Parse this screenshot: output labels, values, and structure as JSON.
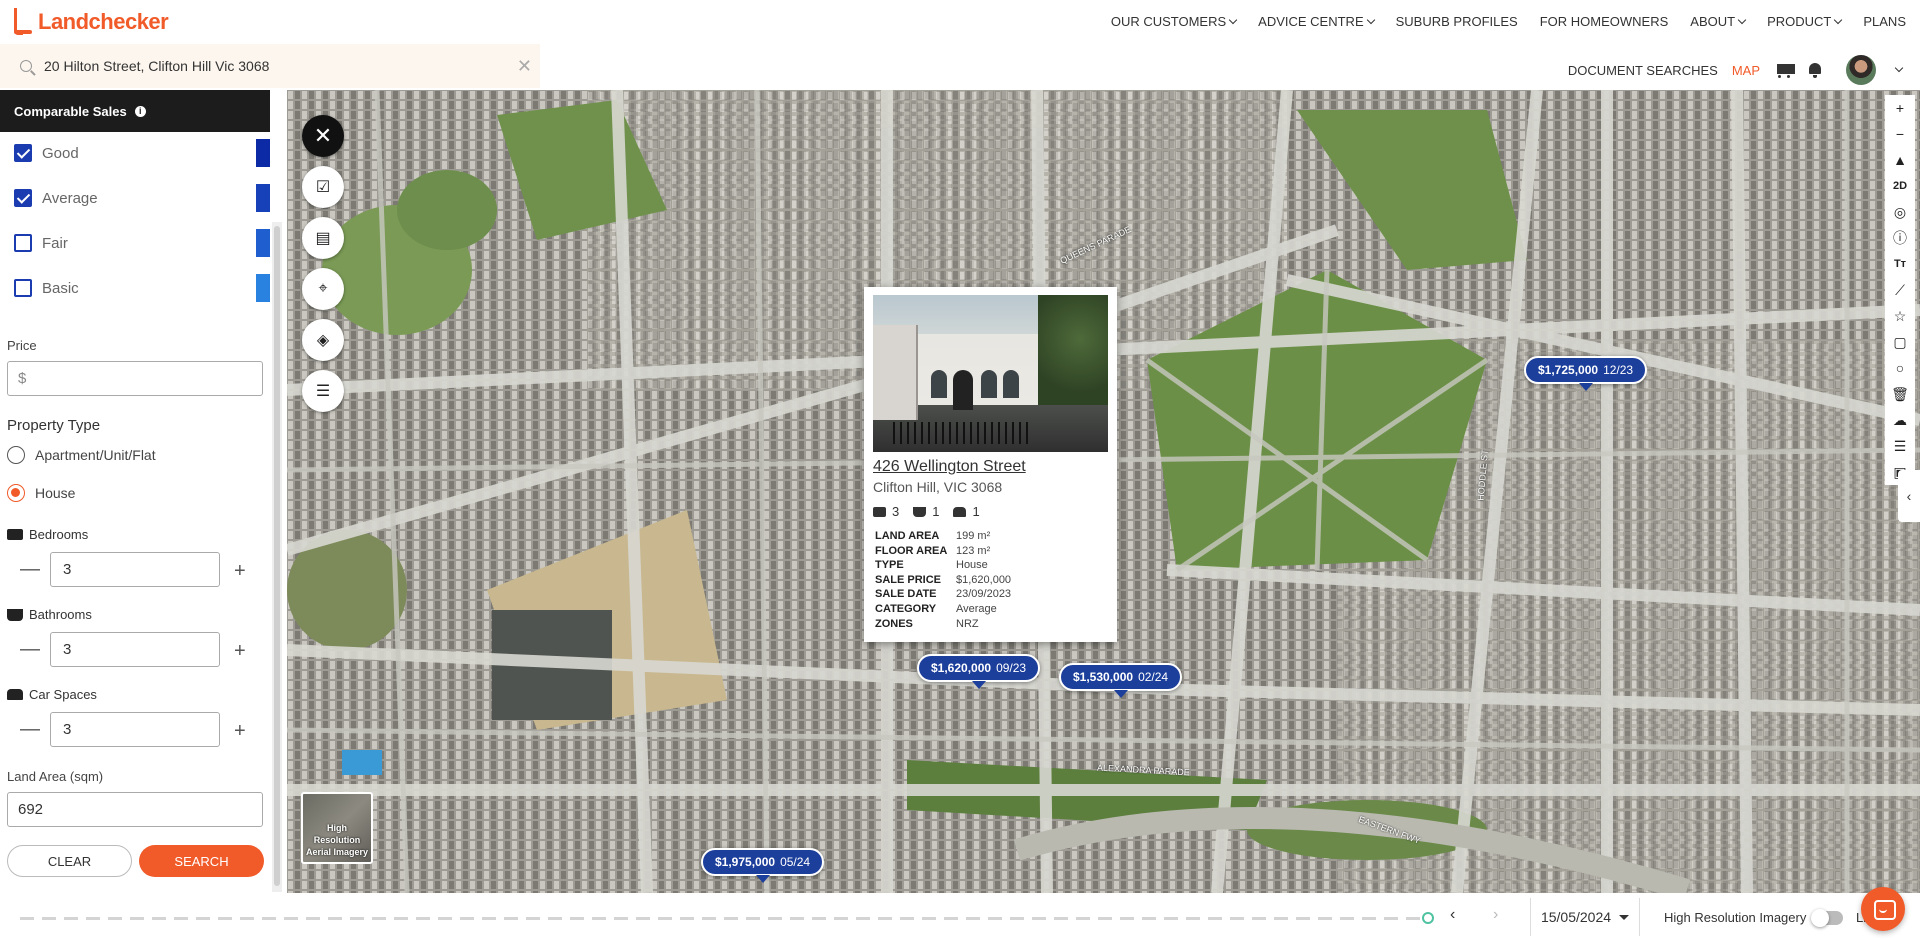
{
  "brand": {
    "name": "Landchecker",
    "accent": "#f15a29"
  },
  "nav": {
    "items": [
      {
        "label": "OUR CUSTOMERS",
        "has_menu": true
      },
      {
        "label": "ADVICE CENTRE",
        "has_menu": true
      },
      {
        "label": "SUBURB PROFILES",
        "has_menu": false
      },
      {
        "label": "FOR HOMEOWNERS",
        "has_menu": false
      },
      {
        "label": "ABOUT",
        "has_menu": true
      },
      {
        "label": "PRODUCT",
        "has_menu": true
      },
      {
        "label": "PLANS",
        "has_menu": false
      }
    ]
  },
  "search": {
    "value": "20 Hilton Street, Clifton Hill Vic 3068",
    "clear_icon": "close-icon"
  },
  "subnav": {
    "document_searches": "DOCUMENT SEARCHES",
    "map": "MAP",
    "cart_icon": "cart-icon",
    "bell_icon": "bell-icon"
  },
  "sidebar": {
    "title": "Comparable Sales",
    "categories": [
      {
        "label": "Good",
        "checked": true,
        "color": "#0d2aa6"
      },
      {
        "label": "Average",
        "checked": true,
        "color": "#1741b8"
      },
      {
        "label": "Fair",
        "checked": false,
        "color": "#1f5ecf"
      },
      {
        "label": "Basic",
        "checked": false,
        "color": "#2a82e0"
      }
    ],
    "price": {
      "label": "Price",
      "placeholder": "$"
    },
    "property_type": {
      "label": "Property Type",
      "options": [
        {
          "label": "Apartment/Unit/Flat",
          "selected": false
        },
        {
          "label": "House",
          "selected": true
        }
      ]
    },
    "bedrooms": {
      "label": "Bedrooms",
      "value": "3"
    },
    "bathrooms": {
      "label": "Bathrooms",
      "value": "3"
    },
    "car_spaces": {
      "label": "Car Spaces",
      "value": "3"
    },
    "land_area": {
      "label": "Land Area (sqm)",
      "value": "692"
    },
    "clear_label": "CLEAR",
    "search_label": "SEARCH"
  },
  "map": {
    "tools": [
      "close-icon",
      "checklist-icon",
      "clipboard-icon",
      "location-search-icon",
      "layers-icon",
      "list-icon"
    ],
    "right_tools": [
      "+",
      "−",
      "▲",
      "2D",
      "◎",
      "ⓘ",
      "Tт",
      "⟋",
      "☆",
      "▢",
      "○",
      "🗑",
      "☁",
      "☰",
      "▣"
    ],
    "imagery_label": "High Resolution Aerial Imagery",
    "markers": [
      {
        "price": "$1,725,000",
        "date": "12/23"
      },
      {
        "price": "$1,620,000",
        "date": "09/23"
      },
      {
        "price": "$1,530,000",
        "date": "02/24"
      },
      {
        "price": "$1,975,000",
        "date": "05/24"
      }
    ],
    "labels": [
      "QUEENS PARADE",
      "ALEXANDRA PARADE",
      "HODDLE ST",
      "EASTERN FWY"
    ]
  },
  "popup": {
    "address": "426 Wellington Street",
    "suburb": "Clifton Hill, VIC 3068",
    "beds": "3",
    "baths": "1",
    "cars": "1",
    "details": [
      {
        "label": "LAND AREA",
        "value": "199 m²"
      },
      {
        "label": "FLOOR AREA",
        "value": "123 m²"
      },
      {
        "label": "TYPE",
        "value": "House"
      },
      {
        "label": "SALE PRICE",
        "value": "$1,620,000"
      },
      {
        "label": "SALE DATE",
        "value": "23/09/2023"
      },
      {
        "label": "CATEGORY",
        "value": "Average"
      },
      {
        "label": "ZONES",
        "value": "NRZ"
      }
    ]
  },
  "timeline": {
    "date": "15/05/2024",
    "hri_label": "High Resolution Imagery",
    "more": "Li"
  }
}
